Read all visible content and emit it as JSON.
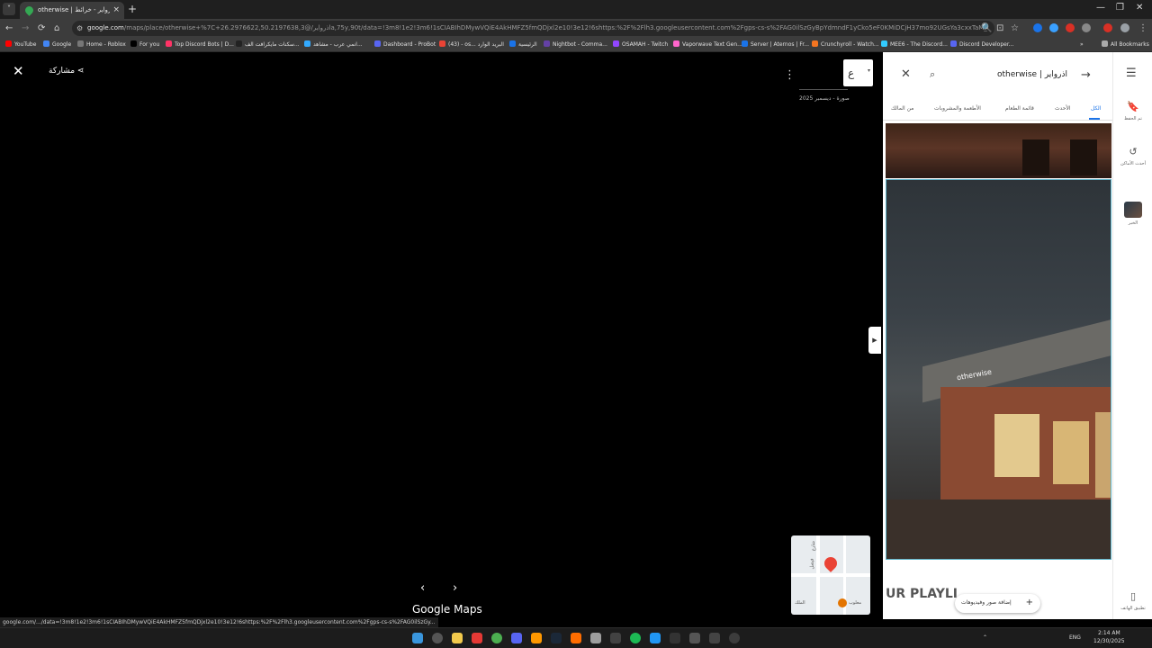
{
  "browser": {
    "tab_title": "otherwise | اذرواير - خرائط Goo",
    "tab_close": "×",
    "new_tab": "+",
    "tab_list": "˅",
    "window_controls": [
      "—",
      "❐",
      "✕"
    ],
    "nav": {
      "back": "←",
      "forward": "→",
      "reload": "⟳",
      "home": "⌂"
    },
    "url_domain": "google.com",
    "url_rest": "/maps/place/otherwise+%7C+اذرواير/@26.2976622,50.2197638,3a,75y,90t/data=!3m8!1e2!3m6!1sCIABIhDMywVQiE4AkHMFZ5fmQDjxl2e10!3e12!6shttps:%2F%2Flh3.googleusercontent.com%2Fgps-cs-s%2FAG0ilSzGyBpYdmndF1yCko5eF0KMiDCjH37mo92UGsYa3cxxTaM_OVOfmtka3qCKSLPs75...",
    "omni_icon": "⚙",
    "omni_actions": [
      "🔍",
      "⊡",
      "☆"
    ],
    "menu": "⋮"
  },
  "bookmarks": [
    {
      "label": "YouTube",
      "color": "#ff0000"
    },
    {
      "label": "Google",
      "color": "#4285f4"
    },
    {
      "label": "Home - Roblox",
      "color": "#777777"
    },
    {
      "label": "For you",
      "color": "#000000"
    },
    {
      "label": "Top Discord Bots | D...",
      "color": "#ff3366"
    },
    {
      "label": "سكنات مايكرافت الف...",
      "color": "#222222"
    },
    {
      "label": "انمي عرب - مشاهد...",
      "color": "#33aaff"
    },
    {
      "label": "Dashboard - ProBot",
      "color": "#5865f2"
    },
    {
      "label": "(43) - os... البريد الوارد",
      "color": "#ea4335"
    },
    {
      "label": "الرئيسية",
      "color": "#1a73e8"
    },
    {
      "label": "Nightbot - Comma...",
      "color": "#6441a5"
    },
    {
      "label": "OSAMAH - Twitch",
      "color": "#9146ff"
    },
    {
      "label": "Vaporwave Text Gen...",
      "color": "#ff66cc"
    },
    {
      "label": "Server | Aternos | Fr...",
      "color": "#1a73e8"
    },
    {
      "label": "Crunchyroll - Watch...",
      "color": "#f47521"
    },
    {
      "label": "MEE6 - The Discord...",
      "color": "#33ccff"
    },
    {
      "label": "Discord Developer...",
      "color": "#5865f2"
    }
  ],
  "bookmarks_more": "»",
  "all_bookmarks": "All Bookmarks",
  "viewer": {
    "close": "✕",
    "share_label": "مشاركة",
    "more": "⋮",
    "avatar_letter": "ع",
    "avatar_dropdown": "▾",
    "date_label": "صورة - ديسمبر 2025",
    "collapse": "▶",
    "prev": "‹",
    "next": "›",
    "brand": "Google Maps"
  },
  "minimap": {
    "labels": [
      "شارع",
      "فيصل",
      "الملك"
    ],
    "poi_label": "معلوب"
  },
  "panel": {
    "search_query": "otherwise | اذرواير",
    "back_arrow": "→",
    "search_icon": "⌕",
    "close": "✕",
    "tabs": [
      "الكل",
      "الأحدث",
      "قائمة الطعام",
      "الأطعمة والمشروبات",
      "من المالك"
    ],
    "sign_text": "otherwise",
    "playlist_text": "UR PLAYLI",
    "add_photo_label": "إضافة صور وفيديوهات",
    "add_photo_plus": "+"
  },
  "rail": {
    "menu": "☰",
    "items": [
      {
        "icon": "🔖",
        "label": "تم الحفظ"
      },
      {
        "icon": "↺",
        "label": "أحدث الأماكن"
      },
      {
        "icon": "",
        "label": "الخبر"
      },
      {
        "icon": "▯",
        "label": "تطبيق الهاتف"
      }
    ]
  },
  "status_url": "google.com/.../data=!3m8!1e2!3m6!1sCIABIhDMywVQiE4AkHMFZ5fmQDjxl2e10!3e12!6shttps:%2F%2Flh3.googleusercontent.com%2Fgps-cs-s%2FAG0ilSzGy...",
  "taskbar": {
    "lang": "ENG",
    "time": "2:14 AM",
    "date": "12/30/2025"
  }
}
